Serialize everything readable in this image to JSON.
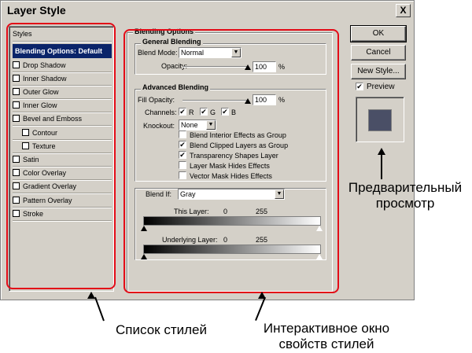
{
  "window": {
    "title": "Layer Style",
    "close_label": "X"
  },
  "styles": {
    "header": "Styles",
    "items": [
      {
        "label": "Blending Options: Default",
        "selected": true,
        "checkbox": false,
        "indent": false
      },
      {
        "label": "Drop Shadow",
        "checkbox": true,
        "indent": false
      },
      {
        "label": "Inner Shadow",
        "checkbox": true,
        "indent": false
      },
      {
        "label": "Outer Glow",
        "checkbox": true,
        "indent": false
      },
      {
        "label": "Inner Glow",
        "checkbox": true,
        "indent": false
      },
      {
        "label": "Bevel and Emboss",
        "checkbox": true,
        "indent": false
      },
      {
        "label": "Contour",
        "checkbox": true,
        "indent": true
      },
      {
        "label": "Texture",
        "checkbox": true,
        "indent": true
      },
      {
        "label": "Satin",
        "checkbox": true,
        "indent": false
      },
      {
        "label": "Color Overlay",
        "checkbox": true,
        "indent": false
      },
      {
        "label": "Gradient Overlay",
        "checkbox": true,
        "indent": false
      },
      {
        "label": "Pattern Overlay",
        "checkbox": true,
        "indent": false
      },
      {
        "label": "Stroke",
        "checkbox": true,
        "indent": false
      }
    ]
  },
  "blending": {
    "title": "Blending Options",
    "general": {
      "title": "General Blending",
      "blend_mode_label": "Blend Mode:",
      "blend_mode_value": "Normal",
      "opacity_label": "Opacity:",
      "opacity_value": "100",
      "percent": "%"
    },
    "advanced": {
      "title": "Advanced Blending",
      "fill_opacity_label": "Fill Opacity:",
      "fill_opacity_value": "100",
      "percent": "%",
      "channels_label": "Channels:",
      "channel_r": "R",
      "channel_g": "G",
      "channel_b": "B",
      "knockout_label": "Knockout:",
      "knockout_value": "None",
      "options": [
        {
          "label": "Blend Interior Effects as Group",
          "checked": false
        },
        {
          "label": "Blend Clipped Layers as Group",
          "checked": true
        },
        {
          "label": "Transparency Shapes Layer",
          "checked": true
        },
        {
          "label": "Layer Mask Hides Effects",
          "checked": false
        },
        {
          "label": "Vector Mask Hides Effects",
          "checked": false
        }
      ]
    },
    "blend_if": {
      "label": "Blend If:",
      "value": "Gray",
      "this_layer_label": "This Layer:",
      "this_layer_min": "0",
      "this_layer_max": "255",
      "underlying_label": "Underlying Layer:",
      "underlying_min": "0",
      "underlying_max": "255"
    }
  },
  "buttons": {
    "ok": "OK",
    "cancel": "Cancel",
    "new_style": "New Style..."
  },
  "preview": {
    "label": "Preview",
    "checked": true,
    "swatch_color": "#4a4f66"
  },
  "check_mark": "✔",
  "annotations": {
    "preview_caption_line1": "Предварительный",
    "preview_caption_line2": "просмотр",
    "styles_caption": "Список стилей",
    "props_caption_line1": "Интерактивное окно",
    "props_caption_line2": "свойств стилей"
  },
  "colors": {
    "highlight": "#e30b17",
    "selection": "#0a246a",
    "dialog": "#d4d0c8"
  }
}
